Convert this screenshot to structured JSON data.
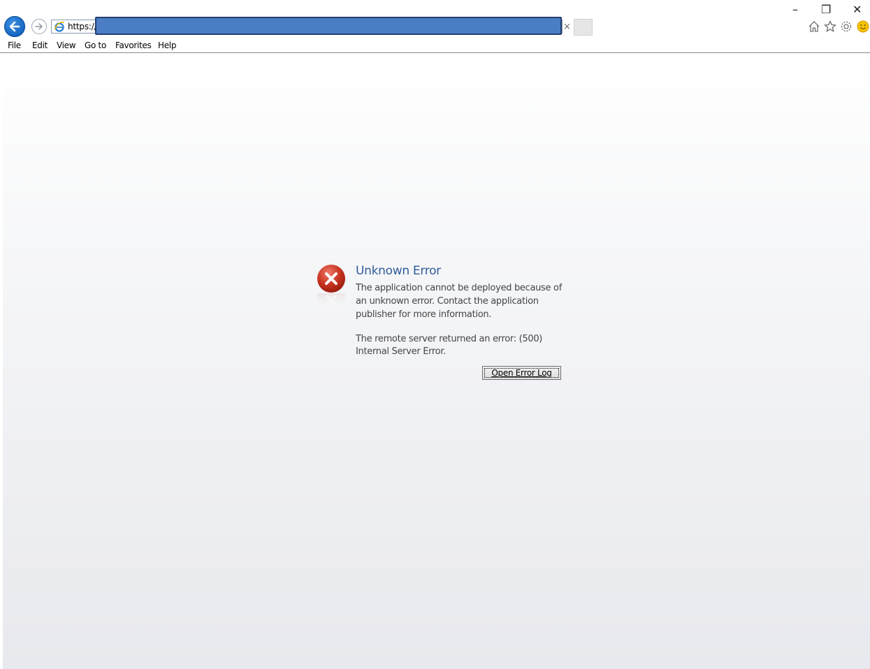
{
  "browser": {
    "address_prefix": "https://",
    "clear_glyph": "×",
    "window_controls": {
      "minimize": "–",
      "restore": "❐",
      "close": "✕"
    },
    "toolbar_icons": [
      "home-icon",
      "favorites-star-icon",
      "settings-gear-icon",
      "feedback-smiley-icon"
    ]
  },
  "menu": {
    "items": [
      "File",
      "Edit",
      "View",
      "Go to",
      "Favorites",
      "Help"
    ]
  },
  "error": {
    "title": "Unknown Error",
    "message": "The application cannot be deployed because of an unknown error. Contact the application publisher for more information.",
    "detail": "The remote server returned an error: (500) Internal Server Error.",
    "button_label": "Open Error Log"
  },
  "colors": {
    "accent_blue": "#2f5c9a",
    "error_red": "#c0392b",
    "redaction": "#4a7dc4"
  }
}
